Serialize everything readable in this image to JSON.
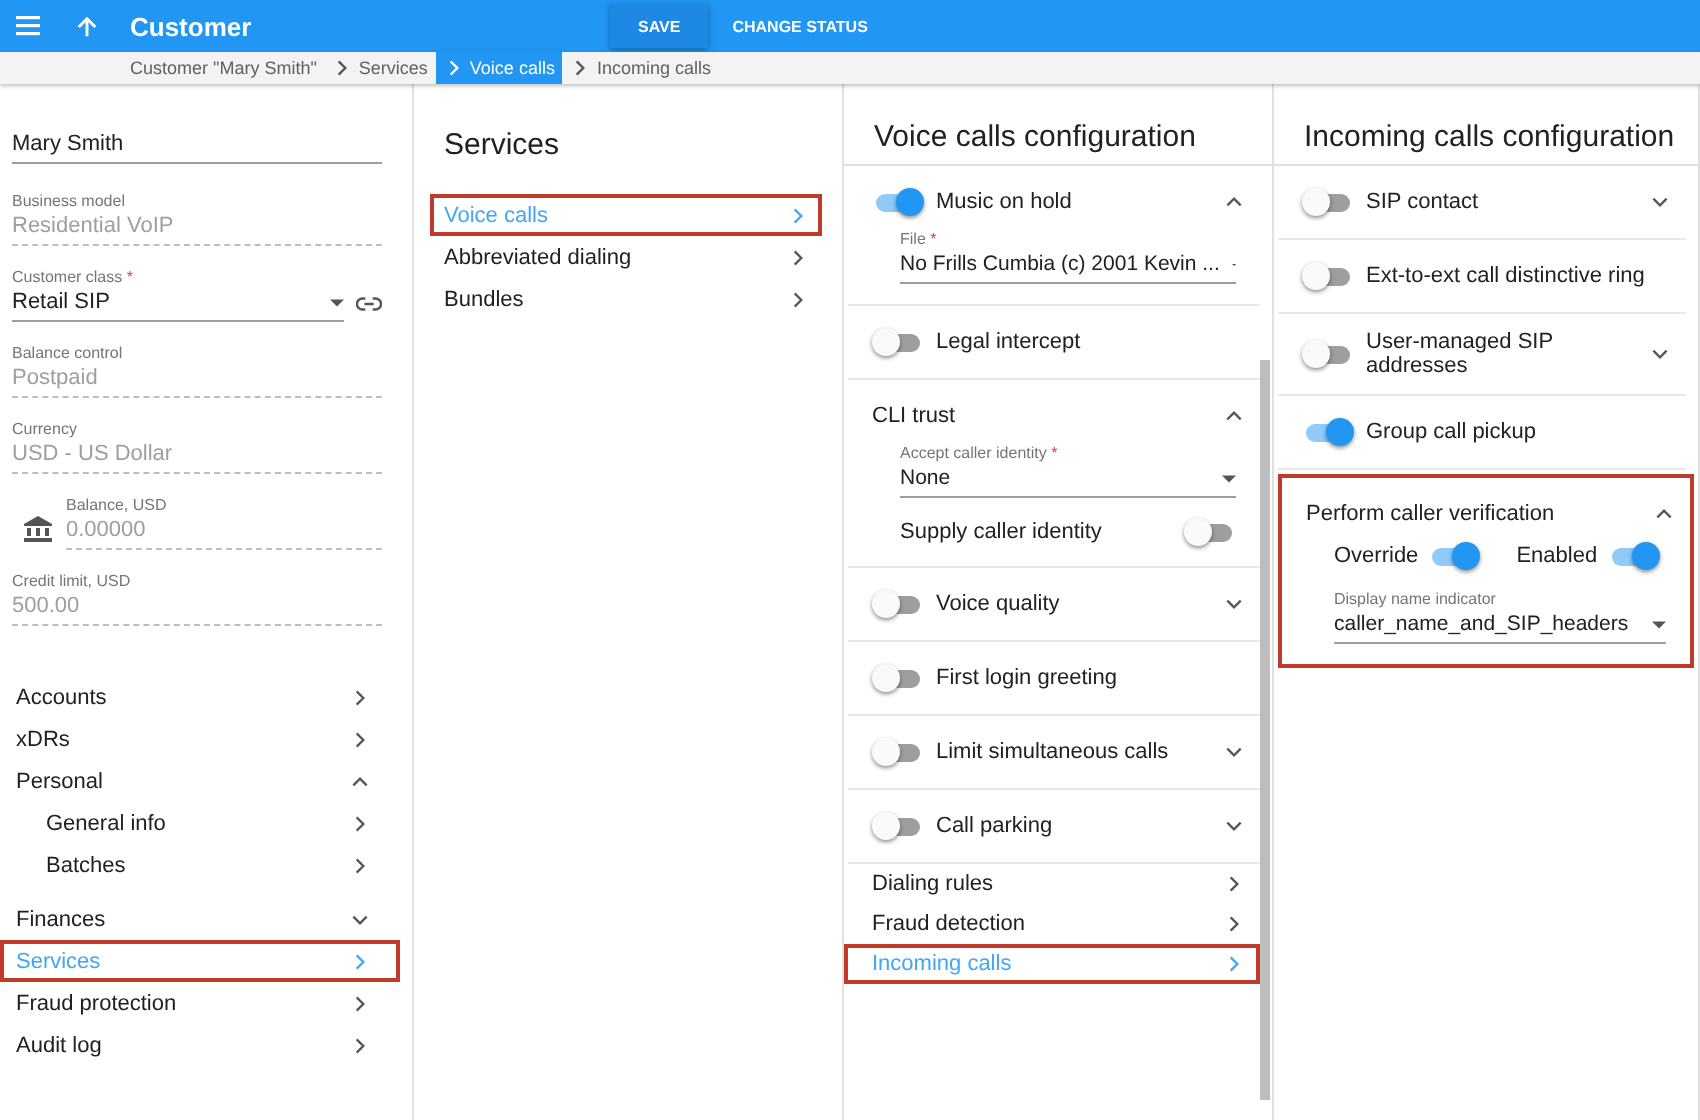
{
  "app_bar": {
    "title": "Customer",
    "buttons": [
      {
        "label": "SAVE",
        "kind": "raised"
      },
      {
        "label": "CHANGE STATUS",
        "kind": "flat"
      }
    ]
  },
  "breadcrumbs": [
    {
      "label": "Customer \"Mary Smith\"",
      "selected": false
    },
    {
      "label": "Services",
      "selected": false
    },
    {
      "label": "Voice calls",
      "selected": true
    },
    {
      "label": "Incoming calls",
      "selected": false
    }
  ],
  "customer": {
    "name": "Mary Smith",
    "fields": [
      {
        "kind": "readonly",
        "label": "Business model",
        "value": "Residential VoIP"
      },
      {
        "kind": "select",
        "label": "Customer class",
        "required_mark": "*",
        "value": "Retail SIP"
      },
      {
        "kind": "readonly",
        "label": "Balance control",
        "value": "Postpaid"
      },
      {
        "kind": "readonly",
        "label": "Currency",
        "value": "USD - US Dollar"
      },
      {
        "kind": "balance",
        "label": "Balance, USD",
        "value": "0.00000"
      },
      {
        "kind": "readonly",
        "label": "Credit limit, USD",
        "value": "500.00"
      }
    ]
  },
  "nav": [
    {
      "label": "Accounts",
      "kind": "link",
      "selected": false,
      "highlighted": false
    },
    {
      "label": "xDRs",
      "kind": "link",
      "selected": false,
      "highlighted": false
    },
    {
      "label": "Personal",
      "kind": "group",
      "expanded": true,
      "selected": false,
      "highlighted": false,
      "children": [
        {
          "label": "General info",
          "kind": "link",
          "selected": false,
          "highlighted": false
        },
        {
          "label": "Batches",
          "kind": "link",
          "selected": false,
          "highlighted": false
        }
      ]
    },
    {
      "label": "Finances",
      "kind": "group",
      "expanded": false,
      "selected": false,
      "highlighted": false
    },
    {
      "label": "Services",
      "kind": "link",
      "selected": true,
      "highlighted": true
    },
    {
      "label": "Fraud protection",
      "kind": "link",
      "selected": false,
      "highlighted": false
    },
    {
      "label": "Audit log",
      "kind": "link",
      "selected": false,
      "highlighted": false
    }
  ],
  "services": {
    "title": "Services",
    "items": [
      {
        "label": "Voice calls",
        "selected": true,
        "highlighted": true
      },
      {
        "label": "Abbreviated dialing",
        "selected": false,
        "highlighted": false
      },
      {
        "label": "Bundles",
        "selected": false,
        "highlighted": false
      }
    ]
  },
  "voice_calls_configuration": {
    "title": "Voice calls configuration",
    "rows": [
      {
        "kind": "toggle",
        "label": "Music on hold",
        "on": true,
        "expanded": true,
        "children": [
          {
            "kind": "select",
            "label": "File",
            "required_mark": "*",
            "value": "No Frills Cumbia (c) 2001 Kevin ..."
          }
        ]
      },
      {
        "kind": "toggle",
        "label": "Legal intercept",
        "on": false
      },
      {
        "kind": "section",
        "label": "CLI trust",
        "expanded": true,
        "highlighted": false,
        "children": [
          {
            "kind": "select",
            "label": "Accept caller identity",
            "required_mark": "*",
            "value": "None"
          },
          {
            "kind": "switch_right",
            "label": "Supply caller identity",
            "on": false
          }
        ]
      },
      {
        "kind": "toggle",
        "label": "Voice quality",
        "on": false,
        "expanded": false
      },
      {
        "kind": "toggle",
        "label": "First login greeting",
        "on": false
      },
      {
        "kind": "toggle",
        "label": "Limit simultaneous calls",
        "on": false,
        "expanded": false
      },
      {
        "kind": "toggle",
        "label": "Call parking",
        "on": false,
        "expanded": false
      },
      {
        "kind": "link",
        "label": "Dialing rules",
        "selected": false,
        "highlighted": false
      },
      {
        "kind": "link",
        "label": "Fraud detection",
        "selected": false,
        "highlighted": false
      },
      {
        "kind": "link",
        "label": "Incoming calls",
        "selected": true,
        "highlighted": true
      }
    ]
  },
  "incoming_calls_configuration": {
    "title": "Incoming calls configuration",
    "rows": [
      {
        "kind": "toggle",
        "label": "SIP contact",
        "on": false,
        "expanded": false
      },
      {
        "kind": "toggle",
        "label": "Ext-to-ext call distinctive ring",
        "on": false
      },
      {
        "kind": "toggle",
        "label": "User-managed SIP addresses",
        "on": false,
        "expanded": false
      },
      {
        "kind": "toggle",
        "label": "Group call pickup",
        "on": true
      },
      {
        "kind": "section",
        "label": "Perform caller verification",
        "expanded": true,
        "highlighted": true,
        "children": [
          {
            "kind": "inline_switches",
            "items": [
              {
                "label": "Override",
                "on": true
              },
              {
                "label": "Enabled",
                "on": true
              }
            ]
          },
          {
            "kind": "select",
            "label": "Display name indicator",
            "value": "caller_name_and_SIP_headers"
          }
        ]
      }
    ]
  }
}
